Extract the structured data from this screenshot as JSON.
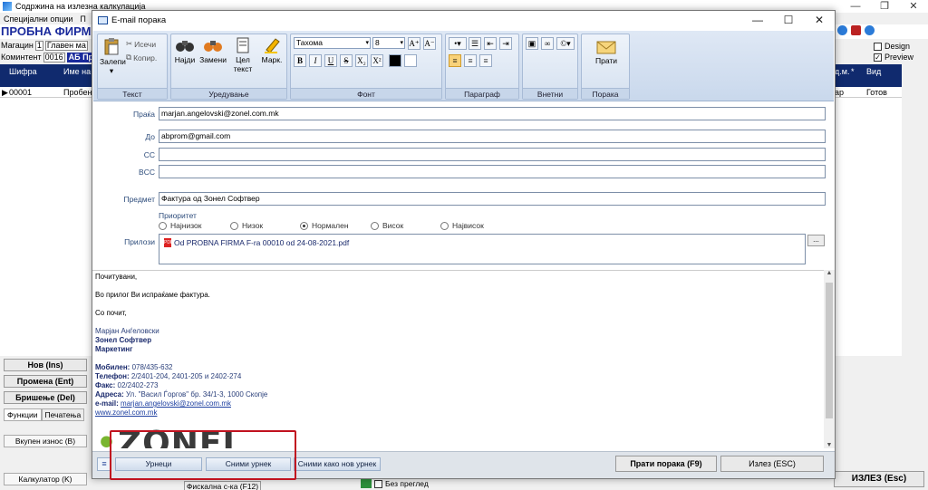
{
  "bg_app": {
    "window_title": "Содржина на излезна калкулација",
    "menu": [
      "Специјални опции",
      "П"
    ],
    "company": "ПРОБНА ФИРМА",
    "magacin_label": "Магацин",
    "magacin_value": "1",
    "glaven_label": "Главен ма",
    "komintent_label": "Коминтент",
    "komintent_code": "0016",
    "komintent_name": "АБ Пром",
    "grid_headers": {
      "sifra": "Шифра",
      "ime": "Име на",
      "dm": "д.м.",
      "star": "*",
      "vid": "Вид"
    },
    "grid_row": {
      "sifra": "00001",
      "ime": "Пробен",
      "dm": "ар",
      "vid": "Готов"
    },
    "design_label": "Design",
    "preview_label": "Preview",
    "btn_new": "Нов (Ins)",
    "btn_edit": "Промена (Ent)",
    "btn_delete": "Бришење (Del)",
    "tab_functions": "Функции",
    "tab_print": "Печатења",
    "btn_total": "Вкупен износ (B)",
    "btn_calc": "Калкулатор (K)",
    "btn_fiscal": "Фискална с-ка (F12)",
    "no_preview": "Без преглед",
    "btn_exit": "ИЗЛЕЗ (Esc)"
  },
  "dialog": {
    "title": "E-mail порака",
    "ribbon": {
      "paste": "Залепи",
      "cut": "Исечи",
      "copy": "Копир.",
      "group_text": "Текст",
      "find": "Најди",
      "replace": "Замени",
      "whole_text": "Цел текст",
      "mark": "Марк.",
      "group_edit": "Уредување",
      "font_name": "Тахома",
      "font_size": "8",
      "group_font": "Фонт",
      "group_paragraph": "Параграф",
      "group_insert": "Внетни",
      "send": "Прати",
      "group_message": "Порака"
    },
    "fields": {
      "from_label": "Праќа",
      "from_value": "marjan.angelovski@zonel.com.mk",
      "to_label": "До",
      "to_value": "abprom@gmail.com",
      "cc_label": "CC",
      "cc_value": "",
      "bcc_label": "BCC",
      "bcc_value": "",
      "subject_label": "Предмет",
      "subject_value": "Фактура од Зонел Софтвер",
      "priority_label": "Приоритет",
      "priorities": [
        "Најнизок",
        "Низок",
        "Нормален",
        "Висок",
        "Највисок"
      ],
      "priority_selected": 2,
      "attachments_label": "Прилози",
      "attachment": "Od PROBNA FIRMA F-ra 00010 od 24-08-2021.pdf",
      "attach_btn": "..."
    },
    "body": {
      "greeting": "Почитувани,",
      "line1": "Во прилог Ви испраќаме фактура.",
      "regards": "Со почит,",
      "sig_name": "Марјан Анѓеловски",
      "sig_company": "Зонел Софтвер",
      "sig_dept": "Маркетинг",
      "mobile_label": "Мобилен:",
      "mobile": "078/435-632",
      "phone_label": "Телефон:",
      "phone": "2/2401-204, 2401-205  и  2402-274",
      "fax_label": "Факс:",
      "fax": "02/2402-273",
      "address_label": "Адреса:",
      "address": "Ул. \"Васил Ѓоргов\" бр. 34/1-3, 1000 Скопје",
      "email_label": "e-mail:",
      "email": "marjan.angelovski@zonel.com.mk",
      "web": "www.zonel.com.mk",
      "logo_text": "ZONEL"
    },
    "footer": {
      "templates": "Урнеци",
      "save_template": "Сними урнек",
      "save_as_template": "Сними како нов урнек",
      "send_btn": "Прати порака (F9)",
      "exit_btn": "Излез (ESC)"
    }
  }
}
